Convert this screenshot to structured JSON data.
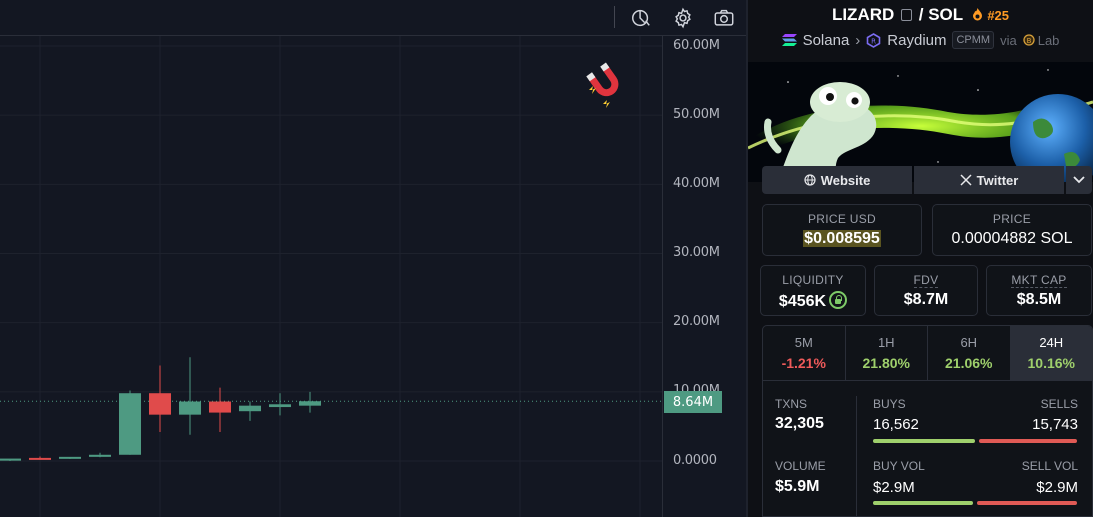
{
  "toolbar": {
    "icons": [
      "indicator-icon",
      "settings-icon",
      "camera-icon"
    ]
  },
  "price_scale": {
    "ticks": [
      "60.00M",
      "50.00M",
      "40.00M",
      "30.00M",
      "20.00M",
      "10.00M",
      "0.0000"
    ],
    "last_value": "8.64M"
  },
  "chart_data": {
    "type": "candlestick",
    "y_axis_ticks": [
      "60.00M",
      "50.00M",
      "40.00M",
      "30.00M",
      "20.00M",
      "10.00M",
      "0.0000"
    ],
    "ylim": [
      0,
      60000000
    ],
    "last_value": 8640000,
    "candles": [
      {
        "o": 0.05,
        "h": 0.15,
        "l": 0.0,
        "c": 0.35
      },
      {
        "o": 0.45,
        "h": 0.65,
        "l": 0.3,
        "c": 0.35
      },
      {
        "o": 0.35,
        "h": 0.55,
        "l": 0.3,
        "c": 0.6
      },
      {
        "o": 0.6,
        "h": 1.2,
        "l": 0.55,
        "c": 0.9
      },
      {
        "o": 0.9,
        "h": 10.2,
        "l": 0.9,
        "c": 9.8
      },
      {
        "o": 9.8,
        "h": 13.8,
        "l": 4.2,
        "c": 6.7
      },
      {
        "o": 6.7,
        "h": 15.0,
        "l": 3.8,
        "c": 8.6
      },
      {
        "o": 8.6,
        "h": 10.6,
        "l": 4.2,
        "c": 7.0
      },
      {
        "o": 7.2,
        "h": 8.6,
        "l": 5.8,
        "c": 8.0
      },
      {
        "o": 7.8,
        "h": 9.8,
        "l": 6.6,
        "c": 8.2
      },
      {
        "o": 8.0,
        "h": 10.0,
        "l": 7.0,
        "c": 8.64
      }
    ]
  },
  "pair": {
    "base": "LIZARD",
    "separator": "/",
    "quote": "SOL",
    "rank": "#25",
    "chain": "Solana",
    "dex": "Raydium",
    "pool_type": "CPMM",
    "via_label": "via",
    "via_name": "Lab"
  },
  "links": {
    "website": "Website",
    "twitter": "Twitter"
  },
  "metrics": {
    "price_usd_label": "PRICE USD",
    "price_usd": "$0.008595",
    "price_label": "PRICE",
    "price_sol": "0.00004882 SOL",
    "liquidity_label": "LIQUIDITY",
    "liquidity": "$456K",
    "fdv_label": "FDV",
    "fdv": "$8.7M",
    "mktcap_label": "MKT CAP",
    "mktcap": "$8.5M"
  },
  "timeframes": [
    {
      "label": "5M",
      "change": "-1.21%",
      "positive": false
    },
    {
      "label": "1H",
      "change": "21.80%",
      "positive": true
    },
    {
      "label": "6H",
      "change": "21.06%",
      "positive": true
    },
    {
      "label": "24H",
      "change": "10.16%",
      "positive": true
    }
  ],
  "stats": {
    "txns_label": "TXNS",
    "txns": "32,305",
    "buys_label": "BUYS",
    "buys": "16,562",
    "sells_label": "SELLS",
    "sells": "15,743",
    "volume_label": "VOLUME",
    "volume": "$5.9M",
    "buy_vol_label": "BUY VOL",
    "buy_vol": "$2.9M",
    "sell_vol_label": "SELL VOL",
    "sell_vol": "$2.9M",
    "buys_share": 0.51,
    "buy_vol_share": 0.5
  },
  "colors": {
    "up": "#4e9a82",
    "down": "#e04b4b",
    "accent_orange": "#ff9b24",
    "positive": "#9fd06c",
    "negative": "#ee5a5a"
  }
}
